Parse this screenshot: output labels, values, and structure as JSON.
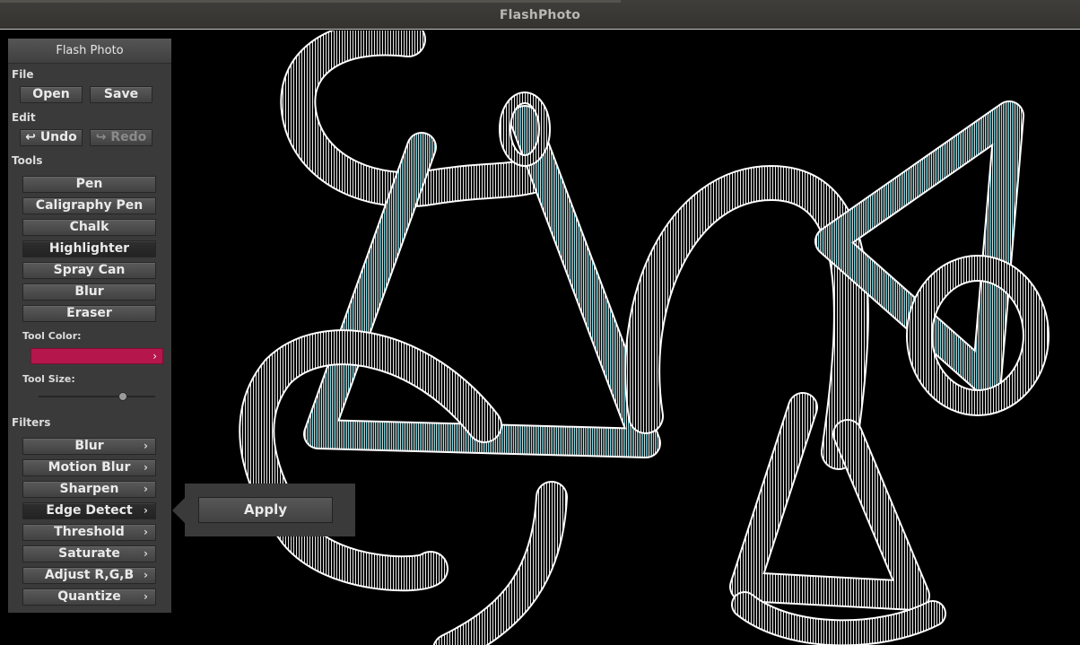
{
  "window": {
    "title": "FlashPhoto"
  },
  "panel": {
    "title": "Flash Photo",
    "file": {
      "label": "File",
      "open": "Open",
      "save": "Save"
    },
    "edit": {
      "label": "Edit",
      "undo": "Undo",
      "redo": "Redo",
      "undo_icon": "↩",
      "redo_icon": "↪"
    },
    "tools": {
      "label": "Tools",
      "items": [
        "Pen",
        "Caligraphy Pen",
        "Chalk",
        "Highlighter",
        "Spray Can",
        "Blur",
        "Eraser"
      ],
      "selected": "Highlighter"
    },
    "tool_color": {
      "label": "Tool Color:",
      "value": "#b5164b",
      "chevron": "›"
    },
    "tool_size": {
      "label": "Tool Size:",
      "value_fraction": 0.72
    },
    "filters": {
      "label": "Filters",
      "items": [
        "Blur",
        "Motion Blur",
        "Sharpen",
        "Edge Detect",
        "Threshold",
        "Saturate",
        "Adjust R,G,B",
        "Quantize"
      ],
      "selected": "Edge Detect",
      "chevron": "›"
    }
  },
  "popup": {
    "apply": "Apply"
  },
  "colors": {
    "edge_white": "#ffffff",
    "edge_cyan": "#6fd8e6",
    "background": "#000000"
  }
}
